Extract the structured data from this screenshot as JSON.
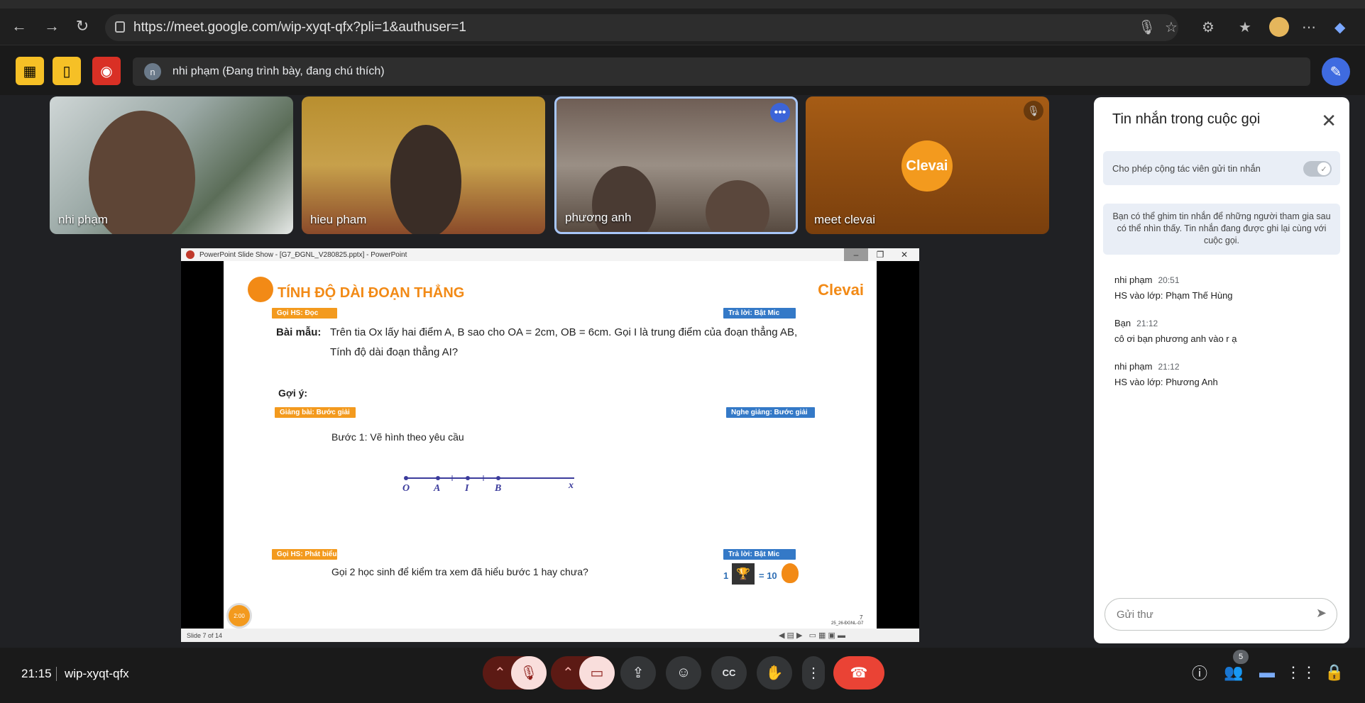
{
  "browser": {
    "url": "https://meet.google.com/wip-xyqt-qfx?pli=1&authuser=1"
  },
  "meet": {
    "presenting_avatar": "n",
    "presenting_text": "nhi phạm (Đang trình bày, đang chú thích)",
    "participants": [
      {
        "name": "nhi phạm"
      },
      {
        "name": "hieu pham"
      },
      {
        "name": "phương anh"
      },
      {
        "name": "meet clevai",
        "logo": "Clevai"
      }
    ]
  },
  "powerpoint": {
    "window_title": "PowerPoint Slide Show - [G7_ĐGNL_V280825.pptx] - PowerPoint",
    "status": "Slide 7 of 14",
    "slide": {
      "title": "TÍNH ĐỘ DÀI ĐOẠN THẲNG",
      "brand": "Clevai",
      "tag1": "Gọi HS: Đọc",
      "tag2": "Trả lời: Bật Mic",
      "example_label": "Bài mẫu:",
      "example_line1": "Trên tia Ox lấy hai điểm A, B sao cho OA = 2cm, OB = 6cm. Gọi I là trung điểm của đoạn thẳng AB,",
      "example_line2": "Tính độ dài đoạn thẳng AI?",
      "hint_label": "Gợi ý:",
      "tag3": "Giảng bài: Bước giải",
      "tag4": "Nghe giảng: Bước giải",
      "step1": "Bước 1: Vẽ hình theo yêu cầu",
      "points": [
        "O",
        "A",
        "I",
        "B",
        "x"
      ],
      "tag5": "Gọi HS: Phát biểu",
      "tag6": "Trả lời: Bật Mic",
      "question": "Gọi 2 học sinh để kiểm tra xem đã hiểu bước 1 hay chưa?",
      "reward_count": "1",
      "reward_equals": "= 10",
      "page_number": "7",
      "page_code": "25_26-ĐGNL-G7",
      "timer": "2:00"
    }
  },
  "chat": {
    "title": "Tin nhắn trong cuộc gọi",
    "permission": "Cho phép cộng tác viên gửi tin nhắn",
    "note": "Bạn có thể ghim tin nhắn để những người tham gia sau có thể nhìn thấy. Tin nhắn đang được ghi lại cùng với cuộc gọi.",
    "messages": [
      {
        "sender": "nhi phạm",
        "time": "20:51",
        "text": "HS vào lớp: Phạm Thế Hùng"
      },
      {
        "sender": "Bạn",
        "time": "21:12",
        "text": "cô ơi bạn phương anh vào r ạ"
      },
      {
        "sender": "nhi phạm",
        "time": "21:12",
        "text": "HS vào lớp: Phương Anh"
      }
    ],
    "input_placeholder": "Gửi thư"
  },
  "bottom": {
    "clock": "21:15",
    "meeting_code": "wip-xyqt-qfx",
    "people_count": "5"
  },
  "colors": {
    "accent": "#3f6be0",
    "end_call": "#ea4335",
    "clevai_orange": "#f39a1e",
    "slide_blue": "#3479c7"
  }
}
